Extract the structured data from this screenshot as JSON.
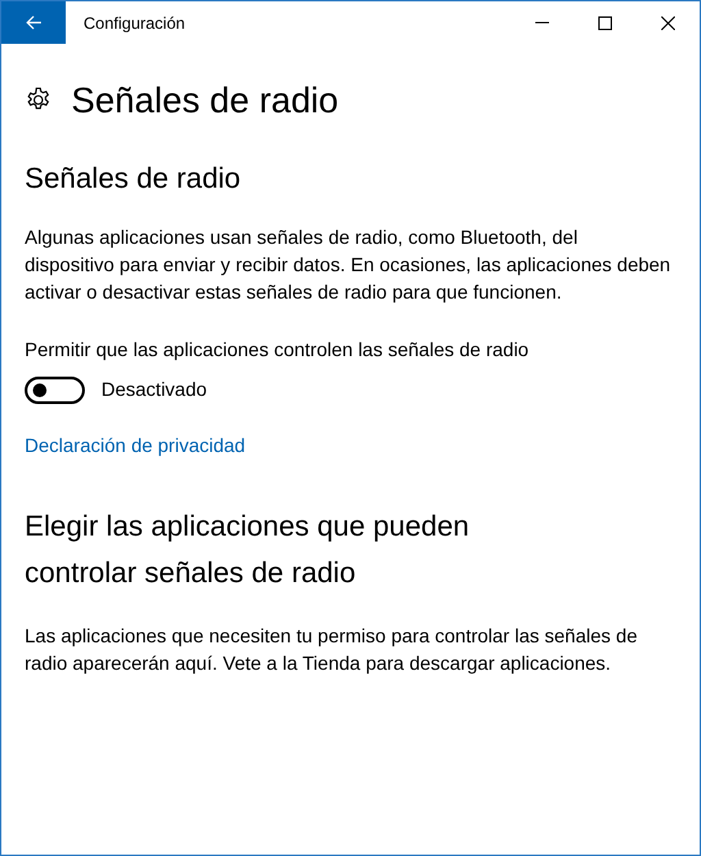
{
  "window": {
    "title": "Configuración"
  },
  "page_title": "Señales de radio",
  "section": {
    "heading": "Señales de radio",
    "description": "Algunas aplicaciones usan señales de radio, como Bluetooth, del dispositivo para enviar y recibir datos. En ocasiones, las aplicaciones deben activar o desactivar estas señales de radio para que funcionen.",
    "toggle": {
      "label": "Permitir que las aplicaciones controlen las señales de radio",
      "on": false,
      "state_text": "Desactivado"
    },
    "link": "Declaración de privacidad"
  },
  "apps_section": {
    "heading": "Elegir las aplicaciones que pueden controlar señales de radio",
    "description": "Las aplicaciones que necesiten tu permiso para controlar las señales de radio aparecerán aquí. Vete a la Tienda para descargar aplicaciones."
  }
}
